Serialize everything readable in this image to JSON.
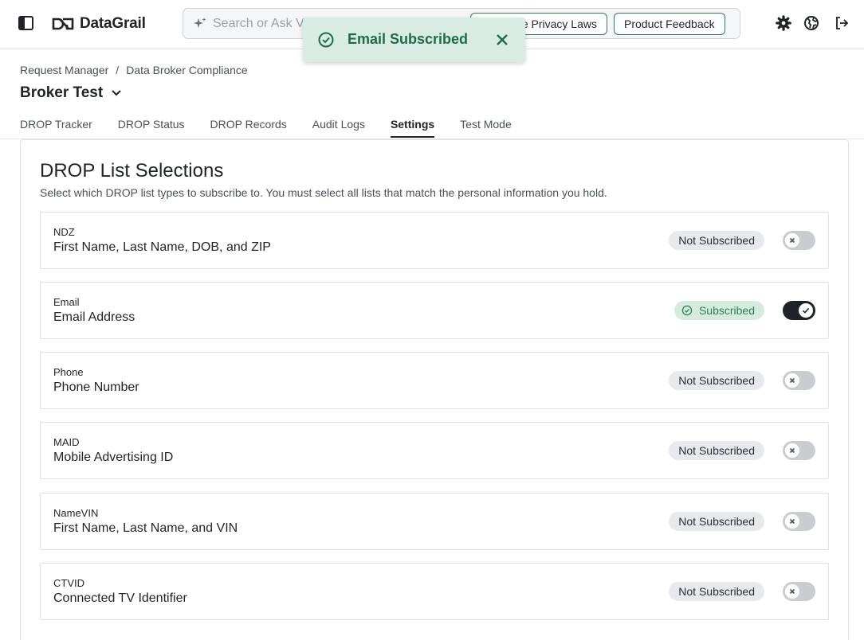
{
  "app": {
    "brand": "DataGrail"
  },
  "search": {
    "placeholder": "Search or Ask V",
    "value": ""
  },
  "header_buttons": {
    "privacy_laws": "e Privacy Laws",
    "feedback": "Product Feedback"
  },
  "toast": {
    "message": "Email Subscribed"
  },
  "breadcrumb": {
    "items": [
      "Request Manager",
      "Data Broker Compliance"
    ],
    "separator": "/"
  },
  "page": {
    "title": "Broker Test"
  },
  "tabs": [
    {
      "label": "DROP Tracker"
    },
    {
      "label": "DROP Status"
    },
    {
      "label": "DROP Records"
    },
    {
      "label": "Audit Logs"
    },
    {
      "label": "Settings"
    },
    {
      "label": "Test Mode"
    }
  ],
  "active_tab": "Settings",
  "panel": {
    "title": "DROP List Selections",
    "subtitle": "Select which DROP list types to subscribe to. You must select all lists that match the personal information you hold."
  },
  "lists": [
    {
      "code": "NDZ",
      "description": "First Name, Last Name, DOB, and ZIP",
      "status": "Not Subscribed",
      "subscribed": false
    },
    {
      "code": "Email",
      "description": "Email Address",
      "status": "Subscribed",
      "subscribed": true
    },
    {
      "code": "Phone",
      "description": "Phone Number",
      "status": "Not Subscribed",
      "subscribed": false
    },
    {
      "code": "MAID",
      "description": "Mobile Advertising ID",
      "status": "Not Subscribed",
      "subscribed": false
    },
    {
      "code": "NameVIN",
      "description": "First Name, Last Name, and VIN",
      "status": "Not Subscribed",
      "subscribed": false
    },
    {
      "code": "CTVID",
      "description": "Connected TV Identifier",
      "status": "Not Subscribed",
      "subscribed": false
    }
  ],
  "colors": {
    "accent": "#2e7d5b",
    "toast_bg": "#d9ece3",
    "toggle_on": "#1f2328",
    "toggle_off": "#c9ccd0"
  },
  "icons": [
    "sidebar-toggle-icon",
    "datagrail-logo-icon",
    "sparkle-icon",
    "gear-icon",
    "globe-icon",
    "logout-icon",
    "check-circle-icon",
    "close-icon",
    "chevron-down-icon"
  ]
}
